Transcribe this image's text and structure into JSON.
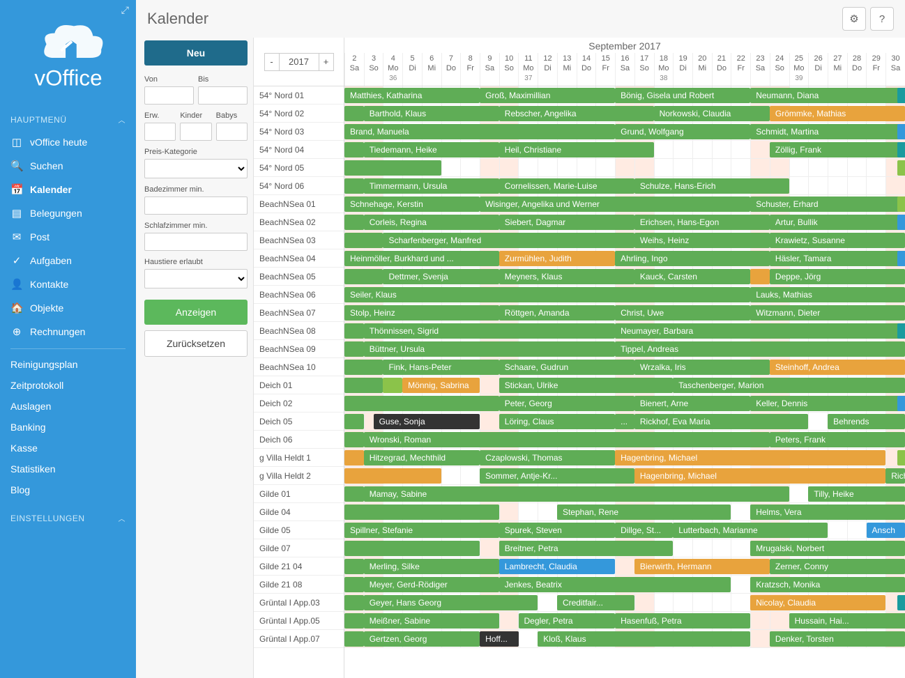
{
  "page_title": "Kalender",
  "sidebar": {
    "brand": "vOffice",
    "main_label": "HAUPTMENÜ",
    "settings_label": "EINSTELLUNGEN",
    "items": [
      {
        "icon": "◫",
        "label": "vOffice heute"
      },
      {
        "icon": "🔍",
        "label": "Suchen"
      },
      {
        "icon": "📅",
        "label": "Kalender",
        "active": true
      },
      {
        "icon": "▤",
        "label": "Belegungen"
      },
      {
        "icon": "✉",
        "label": "Post"
      },
      {
        "icon": "✓",
        "label": "Aufgaben"
      },
      {
        "icon": "👤",
        "label": "Kontakte"
      },
      {
        "icon": "🏠",
        "label": "Objekte"
      },
      {
        "icon": "⊕",
        "label": "Rechnungen"
      }
    ],
    "plain": [
      "Reinigungsplan",
      "Zeitprotokoll",
      "Auslagen",
      "Banking",
      "Kasse",
      "Statistiken",
      "Blog"
    ]
  },
  "filters": {
    "new_label": "Neu",
    "von": "Von",
    "bis": "Bis",
    "erw": "Erw.",
    "kinder": "Kinder",
    "babys": "Babys",
    "preis": "Preis-Kategorie",
    "bad": "Badezimmer min.",
    "schlaf": "Schlafzimmer min.",
    "haustiere": "Haustiere erlaubt",
    "apply": "Anzeigen",
    "reset": "Zurücksetzen"
  },
  "calendar": {
    "year": "2017",
    "month": "September 2017",
    "days": [
      {
        "n": "2",
        "w": "Sa",
        "we": true
      },
      {
        "n": "3",
        "w": "So",
        "we": true
      },
      {
        "n": "4",
        "w": "Mo",
        "wk": "36"
      },
      {
        "n": "5",
        "w": "Di"
      },
      {
        "n": "6",
        "w": "Mi"
      },
      {
        "n": "7",
        "w": "Do"
      },
      {
        "n": "8",
        "w": "Fr"
      },
      {
        "n": "9",
        "w": "Sa",
        "we": true
      },
      {
        "n": "10",
        "w": "So",
        "we": true
      },
      {
        "n": "11",
        "w": "Mo",
        "wk": "37"
      },
      {
        "n": "12",
        "w": "Di"
      },
      {
        "n": "13",
        "w": "Mi"
      },
      {
        "n": "14",
        "w": "Do"
      },
      {
        "n": "15",
        "w": "Fr"
      },
      {
        "n": "16",
        "w": "Sa",
        "we": true
      },
      {
        "n": "17",
        "w": "So",
        "we": true
      },
      {
        "n": "18",
        "w": "Mo",
        "wk": "38"
      },
      {
        "n": "19",
        "w": "Di"
      },
      {
        "n": "20",
        "w": "Mi"
      },
      {
        "n": "21",
        "w": "Do"
      },
      {
        "n": "22",
        "w": "Fr"
      },
      {
        "n": "23",
        "w": "Sa",
        "we": true
      },
      {
        "n": "24",
        "w": "So",
        "we": true
      },
      {
        "n": "25",
        "w": "Mo",
        "wk": "39"
      },
      {
        "n": "26",
        "w": "Di"
      },
      {
        "n": "27",
        "w": "Mi"
      },
      {
        "n": "28",
        "w": "Do"
      },
      {
        "n": "29",
        "w": "Fr"
      },
      {
        "n": "30",
        "w": "Sa",
        "we": true
      }
    ],
    "rooms": [
      "54° Nord 01",
      "54° Nord 02",
      "54° Nord 03",
      "54° Nord 04",
      "54° Nord 05",
      "54° Nord 06",
      "BeachNSea 01",
      "BeachNSea 02",
      "BeachNSea 03",
      "BeachNSea 04",
      "BeachNSea 05",
      "BeachNSea 06",
      "BeachNSea 07",
      "BeachNSea 08",
      "BeachNSea 09",
      "BeachNSea 10",
      "Deich 01",
      "Deich 02",
      "Deich 05",
      "Deich 06",
      "g Villa Heldt 1",
      "g Villa Heldt 2",
      "Gilde 01",
      "Gilde 04",
      "Gilde 05",
      "Gilde 07",
      "Gilde 21 04",
      "Gilde 21 08",
      "Grüntal I App.03",
      "Grüntal I App.05",
      "Grüntal I App.07"
    ],
    "bookings": [
      [
        {
          "s": 0,
          "e": 7,
          "c": "b-green",
          "t": "Matthies, Katharina"
        },
        {
          "s": 7,
          "e": 14,
          "c": "b-green",
          "t": "Groß, Maximillian"
        },
        {
          "s": 14,
          "e": 21,
          "c": "b-green",
          "t": "Bönig, Gisela und Robert"
        },
        {
          "s": 21,
          "e": 29,
          "c": "b-green",
          "t": "Neumann, Diana"
        },
        {
          "s": 28.6,
          "e": 29,
          "c": "b-teal",
          "t": ""
        }
      ],
      [
        {
          "s": 0,
          "e": 1,
          "c": "b-green",
          "t": ""
        },
        {
          "s": 1,
          "e": 8,
          "c": "b-green",
          "t": "Barthold, Klaus"
        },
        {
          "s": 8,
          "e": 16,
          "c": "b-green",
          "t": "Rebscher, Angelika"
        },
        {
          "s": 16,
          "e": 22,
          "c": "b-green",
          "t": "Norkowski, Claudia"
        },
        {
          "s": 22,
          "e": 29,
          "c": "b-orange",
          "t": "Grömmke, Mathias"
        }
      ],
      [
        {
          "s": 0,
          "e": 14,
          "c": "b-green",
          "t": "Brand, Manuela"
        },
        {
          "s": 14,
          "e": 21,
          "c": "b-green",
          "t": "Grund, Wolfgang"
        },
        {
          "s": 21,
          "e": 29,
          "c": "b-green",
          "t": "Schmidt, Martina"
        },
        {
          "s": 28.6,
          "e": 29,
          "c": "b-blue",
          "t": ""
        }
      ],
      [
        {
          "s": 0,
          "e": 1,
          "c": "b-green",
          "t": ""
        },
        {
          "s": 1,
          "e": 8,
          "c": "b-green",
          "t": "Tiedemann, Heike"
        },
        {
          "s": 8,
          "e": 16,
          "c": "b-green",
          "t": "Heil, Christiane"
        },
        {
          "s": 22,
          "e": 29,
          "c": "b-green",
          "t": "Zöllig, Frank"
        },
        {
          "s": 28.6,
          "e": 29,
          "c": "b-teal",
          "t": ""
        }
      ],
      [
        {
          "s": 0,
          "e": 5,
          "c": "b-green",
          "t": ""
        },
        {
          "s": 28.6,
          "e": 29,
          "c": "b-lgreen",
          "t": ""
        }
      ],
      [
        {
          "s": 0,
          "e": 1,
          "c": "b-green",
          "t": ""
        },
        {
          "s": 1,
          "e": 8,
          "c": "b-green",
          "t": "Timmermann, Ursula"
        },
        {
          "s": 8,
          "e": 15,
          "c": "b-green",
          "t": "Cornelissen, Marie-Luise"
        },
        {
          "s": 15,
          "e": 23,
          "c": "b-green",
          "t": "Schulze, Hans-Erich"
        }
      ],
      [
        {
          "s": 0,
          "e": 7,
          "c": "b-green",
          "t": "Schnehage, Kerstin"
        },
        {
          "s": 7,
          "e": 21,
          "c": "b-green",
          "t": "Wisinger, Angelika und Werner"
        },
        {
          "s": 21,
          "e": 29,
          "c": "b-green",
          "t": "Schuster, Erhard"
        },
        {
          "s": 28.6,
          "e": 29,
          "c": "b-lgreen",
          "t": ""
        }
      ],
      [
        {
          "s": 0,
          "e": 1,
          "c": "b-green",
          "t": ""
        },
        {
          "s": 1,
          "e": 8,
          "c": "b-green",
          "t": "Corleis, Regina"
        },
        {
          "s": 8,
          "e": 15,
          "c": "b-green",
          "t": "Siebert, Dagmar"
        },
        {
          "s": 15,
          "e": 22,
          "c": "b-green",
          "t": "Erichsen, Hans-Egon"
        },
        {
          "s": 22,
          "e": 29,
          "c": "b-green",
          "t": "Artur, Bullik"
        },
        {
          "s": 28.6,
          "e": 29,
          "c": "b-blue",
          "t": ""
        }
      ],
      [
        {
          "s": 0,
          "e": 2,
          "c": "b-green",
          "t": ""
        },
        {
          "s": 2,
          "e": 15,
          "c": "b-green",
          "t": "Scharfenberger, Manfred"
        },
        {
          "s": 15,
          "e": 22,
          "c": "b-green",
          "t": "Weihs, Heinz"
        },
        {
          "s": 22,
          "e": 29,
          "c": "b-green",
          "t": "Krawietz, Susanne"
        }
      ],
      [
        {
          "s": 0,
          "e": 8,
          "c": "b-green",
          "t": "Heinmöller, Burkhard und ..."
        },
        {
          "s": 8,
          "e": 14,
          "c": "b-orange",
          "t": "Zurmühlen, Judith"
        },
        {
          "s": 14,
          "e": 22,
          "c": "b-green",
          "t": "Ahrling, Ingo"
        },
        {
          "s": 22,
          "e": 29,
          "c": "b-green",
          "t": "Häsler, Tamara"
        },
        {
          "s": 28.6,
          "e": 29,
          "c": "b-blue",
          "t": ""
        }
      ],
      [
        {
          "s": 0,
          "e": 2,
          "c": "b-green",
          "t": ""
        },
        {
          "s": 2,
          "e": 8,
          "c": "b-green",
          "t": "Dettmer, Svenja"
        },
        {
          "s": 8,
          "e": 15,
          "c": "b-green",
          "t": "Meyners, Klaus"
        },
        {
          "s": 15,
          "e": 21,
          "c": "b-green",
          "t": "Kauck, Carsten"
        },
        {
          "s": 21,
          "e": 22,
          "c": "b-orange",
          "t": ""
        },
        {
          "s": 22,
          "e": 29,
          "c": "b-green",
          "t": "Deppe, Jörg"
        }
      ],
      [
        {
          "s": 0,
          "e": 21,
          "c": "b-green",
          "t": "Seiler, Klaus"
        },
        {
          "s": 21,
          "e": 29,
          "c": "b-green",
          "t": "Lauks, Mathias"
        }
      ],
      [
        {
          "s": -1,
          "e": 8,
          "c": "b-green",
          "t": "Stolp, Heinz"
        },
        {
          "s": 8,
          "e": 14,
          "c": "b-green",
          "t": "Röttgen, Amanda"
        },
        {
          "s": 14,
          "e": 21,
          "c": "b-green",
          "t": "Christ, Uwe"
        },
        {
          "s": 21,
          "e": 29,
          "c": "b-green",
          "t": "Witzmann, Dieter"
        }
      ],
      [
        {
          "s": 0,
          "e": 1,
          "c": "b-green",
          "t": ""
        },
        {
          "s": 1,
          "e": 14,
          "c": "b-green",
          "t": "Thönnissen, Sigrid"
        },
        {
          "s": 14,
          "e": 29,
          "c": "b-green",
          "t": "Neumayer, Barbara"
        },
        {
          "s": 28.6,
          "e": 29,
          "c": "b-teal",
          "t": ""
        }
      ],
      [
        {
          "s": 0,
          "e": 1,
          "c": "b-green",
          "t": ""
        },
        {
          "s": 1,
          "e": 14,
          "c": "b-green",
          "t": "Büttner, Ursula"
        },
        {
          "s": 14,
          "e": 29,
          "c": "b-green",
          "t": "Tippel, Andreas"
        }
      ],
      [
        {
          "s": 0,
          "e": 2,
          "c": "b-green",
          "t": ""
        },
        {
          "s": 2,
          "e": 8,
          "c": "b-green",
          "t": "Fink, Hans-Peter"
        },
        {
          "s": 8,
          "e": 15,
          "c": "b-green",
          "t": "Schaare, Gudrun"
        },
        {
          "s": 15,
          "e": 22,
          "c": "b-green",
          "t": "Wrzalka, Iris"
        },
        {
          "s": 22,
          "e": 29,
          "c": "b-orange",
          "t": "Steinhoff, Andrea"
        }
      ],
      [
        {
          "s": 0,
          "e": 2,
          "c": "b-green",
          "t": ""
        },
        {
          "s": 2,
          "e": 3,
          "c": "b-lgreen",
          "t": ""
        },
        {
          "s": 3,
          "e": 7,
          "c": "b-orange",
          "t": "Mönnig, Sabrina"
        },
        {
          "s": 8,
          "e": 17,
          "c": "b-green",
          "t": "Stickan, Ulrike"
        },
        {
          "s": 17,
          "e": 29,
          "c": "b-green",
          "t": "Taschenberger, Marion"
        }
      ],
      [
        {
          "s": 0,
          "e": 8,
          "c": "b-green",
          "t": ""
        },
        {
          "s": 8,
          "e": 15,
          "c": "b-green",
          "t": "Peter, Georg"
        },
        {
          "s": 15,
          "e": 21,
          "c": "b-green",
          "t": "Bienert, Arne"
        },
        {
          "s": 21,
          "e": 29,
          "c": "b-green",
          "t": "Keller, Dennis"
        },
        {
          "s": 28.6,
          "e": 29,
          "c": "b-blue",
          "t": ""
        }
      ],
      [
        {
          "s": 0,
          "e": 1,
          "c": "b-green",
          "t": ""
        },
        {
          "s": 1.5,
          "e": 7,
          "c": "b-black",
          "t": "Guse, Sonja"
        },
        {
          "s": 8,
          "e": 14,
          "c": "b-green",
          "t": "Löring, Claus"
        },
        {
          "s": 14,
          "e": 15,
          "c": "b-green",
          "t": "..."
        },
        {
          "s": 15,
          "e": 24,
          "c": "b-green",
          "t": "Rickhof, Eva Maria"
        },
        {
          "s": 25,
          "e": 29,
          "c": "b-green",
          "t": "Behrends"
        }
      ],
      [
        {
          "s": 0,
          "e": 1,
          "c": "b-green",
          "t": ""
        },
        {
          "s": 1,
          "e": 22,
          "c": "b-green",
          "t": "Wronski, Roman"
        },
        {
          "s": 22,
          "e": 29,
          "c": "b-green",
          "t": "Peters, Frank"
        }
      ],
      [
        {
          "s": 0,
          "e": 1,
          "c": "b-orange",
          "t": ""
        },
        {
          "s": 1,
          "e": 7,
          "c": "b-green",
          "t": "Hitzegrad, Mechthild"
        },
        {
          "s": 7,
          "e": 14,
          "c": "b-green",
          "t": "Czaplowski, Thomas"
        },
        {
          "s": 14,
          "e": 28,
          "c": "b-orange",
          "t": "Hagenbring, Michael"
        },
        {
          "s": 28.6,
          "e": 29,
          "c": "b-lgreen",
          "t": ""
        }
      ],
      [
        {
          "s": 0,
          "e": 5,
          "c": "b-orange",
          "t": ""
        },
        {
          "s": 7,
          "e": 15,
          "c": "b-green",
          "t": "Sommer, Antje-Kr..."
        },
        {
          "s": 15,
          "e": 28,
          "c": "b-orange",
          "t": "Hagenbring, Michael"
        },
        {
          "s": 28,
          "e": 29,
          "c": "b-green",
          "t": "Richa"
        }
      ],
      [
        {
          "s": 0,
          "e": 1,
          "c": "b-green",
          "t": ""
        },
        {
          "s": 1,
          "e": 23,
          "c": "b-green",
          "t": "Mamay, Sabine"
        },
        {
          "s": 24,
          "e": 29,
          "c": "b-green",
          "t": "Tilly, Heike"
        }
      ],
      [
        {
          "s": 0,
          "e": 8,
          "c": "b-green",
          "t": ""
        },
        {
          "s": 11,
          "e": 20,
          "c": "b-green",
          "t": "Stephan, Rene"
        },
        {
          "s": 21,
          "e": 29,
          "c": "b-green",
          "t": "Helms, Vera"
        }
      ],
      [
        {
          "s": -1,
          "e": 8,
          "c": "b-green",
          "t": "Spillner, Stefanie"
        },
        {
          "s": 8,
          "e": 14,
          "c": "b-green",
          "t": "Spurek, Steven"
        },
        {
          "s": 14,
          "e": 17,
          "c": "b-green",
          "t": "Dillge, St..."
        },
        {
          "s": 17,
          "e": 25,
          "c": "b-green",
          "t": "Lutterbach, Marianne"
        },
        {
          "s": 27,
          "e": 29,
          "c": "b-blue",
          "t": "Ansch"
        }
      ],
      [
        {
          "s": 0,
          "e": 7,
          "c": "b-green",
          "t": ""
        },
        {
          "s": 8,
          "e": 17,
          "c": "b-green",
          "t": "Breitner, Petra"
        },
        {
          "s": 21,
          "e": 29,
          "c": "b-green",
          "t": "Mrugalski, Norbert"
        }
      ],
      [
        {
          "s": 0,
          "e": 1,
          "c": "b-green",
          "t": ""
        },
        {
          "s": 1,
          "e": 8,
          "c": "b-green",
          "t": "Merling, Silke"
        },
        {
          "s": 8,
          "e": 14,
          "c": "b-blue",
          "t": "Lambrecht, Claudia"
        },
        {
          "s": 15,
          "e": 22,
          "c": "b-orange",
          "t": "Bierwirth, Hermann"
        },
        {
          "s": 22,
          "e": 29,
          "c": "b-green",
          "t": "Zerner, Conny"
        }
      ],
      [
        {
          "s": 0,
          "e": 1,
          "c": "b-green",
          "t": ""
        },
        {
          "s": 1,
          "e": 8,
          "c": "b-green",
          "t": "Meyer, Gerd-Rödiger"
        },
        {
          "s": 8,
          "e": 20,
          "c": "b-green",
          "t": "Jenkes, Beatrix"
        },
        {
          "s": 21,
          "e": 29,
          "c": "b-green",
          "t": "Kratzsch, Monika"
        }
      ],
      [
        {
          "s": 0,
          "e": 1,
          "c": "b-green",
          "t": ""
        },
        {
          "s": 1,
          "e": 10,
          "c": "b-green",
          "t": "Geyer, Hans Georg"
        },
        {
          "s": 11,
          "e": 15,
          "c": "b-green",
          "t": "Creditfair..."
        },
        {
          "s": 21,
          "e": 28,
          "c": "b-orange",
          "t": "Nicolay, Claudia"
        },
        {
          "s": 28.6,
          "e": 29,
          "c": "b-teal",
          "t": ""
        }
      ],
      [
        {
          "s": 0,
          "e": 1,
          "c": "b-green",
          "t": ""
        },
        {
          "s": 1,
          "e": 8,
          "c": "b-green",
          "t": "Meißner, Sabine"
        },
        {
          "s": 9,
          "e": 14,
          "c": "b-green",
          "t": "Degler, Petra"
        },
        {
          "s": 14,
          "e": 21,
          "c": "b-green",
          "t": "Hasenfuß, Petra"
        },
        {
          "s": 23,
          "e": 29,
          "c": "b-green",
          "t": "Hussain, Hai..."
        },
        {
          "s": 28.6,
          "e": 29,
          "c": "b-green",
          "t": ""
        }
      ],
      [
        {
          "s": 0,
          "e": 1,
          "c": "b-green",
          "t": ""
        },
        {
          "s": 1,
          "e": 7,
          "c": "b-green",
          "t": "Gertzen, Georg"
        },
        {
          "s": 7,
          "e": 9,
          "c": "b-black",
          "t": "Hoff..."
        },
        {
          "s": 10,
          "e": 21,
          "c": "b-green",
          "t": "Kloß, Klaus"
        },
        {
          "s": 22,
          "e": 29,
          "c": "b-green",
          "t": "Denker, Torsten"
        }
      ]
    ]
  }
}
